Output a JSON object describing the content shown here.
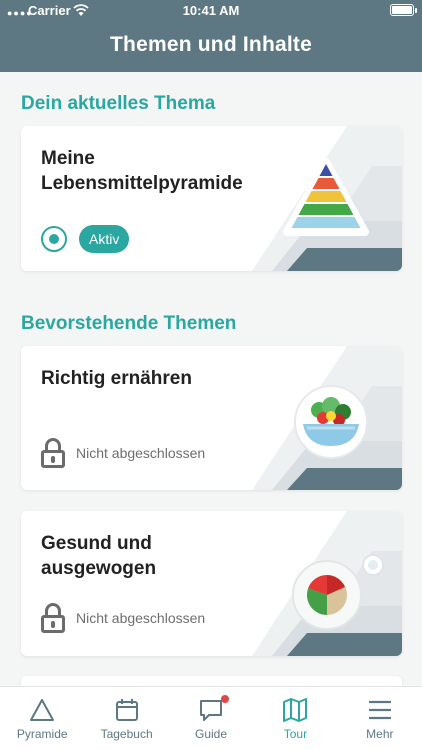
{
  "status_bar": {
    "carrier": "Carrier",
    "time": "10:41 AM"
  },
  "header": {
    "title": "Themen und Inhalte"
  },
  "current_section": {
    "title": "Dein aktuelles Thema",
    "card": {
      "title": "Meine Lebensmittelpyramide",
      "status": "Aktiv"
    }
  },
  "upcoming_section": {
    "title": "Bevorstehende Themen",
    "cards": [
      {
        "title": "Richtig ernähren",
        "status": "Nicht abgeschlossen"
      },
      {
        "title": "Gesund und ausgewogen",
        "status": "Nicht abgeschlossen"
      }
    ]
  },
  "tabbar": {
    "items": [
      {
        "label": "Pyramide",
        "icon": "triangle-icon"
      },
      {
        "label": "Tagebuch",
        "icon": "calendar-icon"
      },
      {
        "label": "Guide",
        "icon": "chat-icon"
      },
      {
        "label": "Tour",
        "icon": "map-icon"
      },
      {
        "label": "Mehr",
        "icon": "menu-icon"
      }
    ],
    "active": "Tour"
  },
  "colors": {
    "header": "#5d7882",
    "accent": "#2aa7a0",
    "notification": "#e04848"
  }
}
